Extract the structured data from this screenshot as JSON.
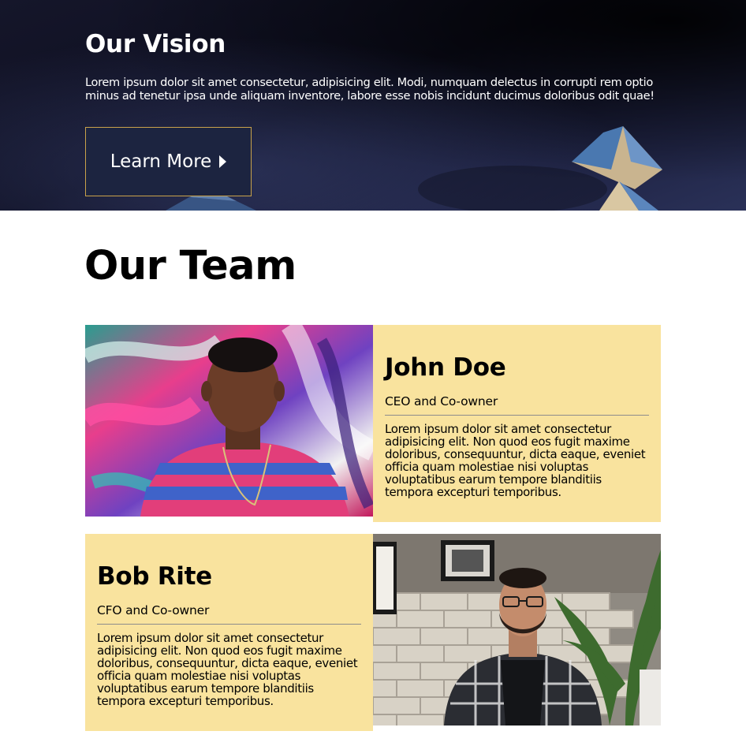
{
  "vision": {
    "title": "Our Vision",
    "text": "Lorem ipsum dolor sit amet consectetur, adipisicing elit. Modi, numquam delectus in corrupti rem optio minus ad tenetur ipsa unde aliquam inventore, labore esse nobis incidunt ducimus doloribus odit quae!",
    "button_label": "Learn More"
  },
  "team": {
    "title": "Our Team",
    "members": [
      {
        "name": "John Doe",
        "role": "CEO and Co-owner",
        "bio": "Lorem ipsum dolor sit amet consectetur adipisicing elit. Non quod eos fugit maxime doloribus, consequuntur, dicta eaque, eveniet officia quam molestiae nisi voluptas voluptatibus earum tempore blanditiis tempora excepturi temporibus."
      },
      {
        "name": "Bob Rite",
        "role": "CFO and Co-owner",
        "bio": "Lorem ipsum dolor sit amet consectetur adipisicing elit. Non quod eos fugit maxime doloribus, consequuntur, dicta eaque, eveniet officia quam molestiae nisi voluptas voluptatibus earum tempore blanditiis tempora excepturi temporibus."
      }
    ]
  },
  "colors": {
    "card_background": "#f9e39e",
    "button_border": "#c9a24a",
    "hero_background": "#15162a"
  },
  "icons": {
    "button_icon": "caret-right-icon"
  }
}
